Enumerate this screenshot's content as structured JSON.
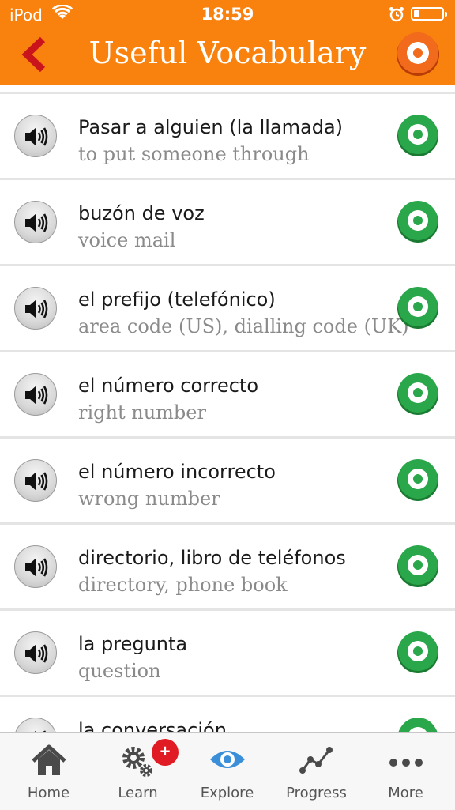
{
  "status": {
    "carrier": "iPod",
    "time": "18:59"
  },
  "header": {
    "title": "Useful Vocabulary",
    "accent_color": "#f9820f"
  },
  "items": [
    {
      "term": "Pasar a alguien (la llamada)",
      "translation": "to put someone through"
    },
    {
      "term": "buzón de voz",
      "translation": "voice mail"
    },
    {
      "term": "el prefijo (telefónico)",
      "translation": "area code (US), dialling code (UK)"
    },
    {
      "term": "el número correcto",
      "translation": "right number"
    },
    {
      "term": "el número incorrecto",
      "translation": "wrong number"
    },
    {
      "term": "directorio, libro de teléfonos",
      "translation": "directory, phone book"
    },
    {
      "term": "la pregunta",
      "translation": "question"
    },
    {
      "term": "la conversación",
      "translation": ""
    }
  ],
  "tabs": [
    {
      "label": "Home",
      "icon": "home-icon"
    },
    {
      "label": "Learn",
      "icon": "gears-icon",
      "badge": "+"
    },
    {
      "label": "Explore",
      "icon": "eye-icon"
    },
    {
      "label": "Progress",
      "icon": "progress-graph-icon"
    },
    {
      "label": "More",
      "icon": "ellipsis-icon"
    }
  ],
  "colors": {
    "target_green": "#2aa74a",
    "target_orange": "#f26a1b",
    "badge_red": "#e01b23",
    "explore_blue": "#3b8fd9"
  }
}
